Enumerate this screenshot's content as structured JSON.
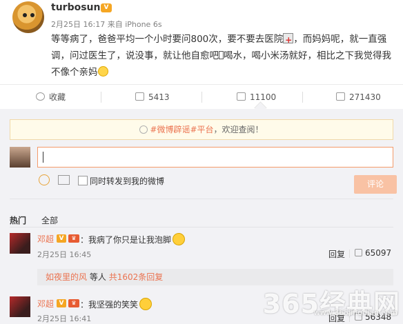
{
  "post": {
    "username": "turbosun",
    "time": "2月25日 16:17",
    "source": "来自 iPhone 6s",
    "text_part1": "等等病了，爸爸平均一个小时要问800次，要不要去医院",
    "text_part2": "，而妈妈呢，就一直强调，问过医生了，说没事，就让他自愈吧",
    "text_part3": "喝水，喝小米汤就好，相比之下我觉得我不像个亲妈"
  },
  "actions": {
    "favorite_label": "收藏",
    "repost_count": "5413",
    "comment_count": "11100",
    "like_count": "271430"
  },
  "notice": {
    "topic": "#微博辟谣#平台",
    "suffix": "，欢迎查阅！"
  },
  "composer": {
    "input_value": "",
    "repost_checkbox_label": "同时转发到我的微博",
    "submit_label": "评论"
  },
  "tabs": {
    "hot": "热门",
    "all": "全部"
  },
  "comments": [
    {
      "name": "邓超",
      "text": "：我病了你只是让我泡脚",
      "time": "2月25日 16:45",
      "reply_label": "回复",
      "likes": "65097"
    },
    {
      "name": "邓超",
      "text": "：我坚强的笑笑",
      "time": "2月25日 16:41",
      "reply_label": "回复",
      "likes": "56348"
    }
  ],
  "subreplies": {
    "first_user": "如夜里的风",
    "middle": "等人",
    "total": "共1602条回复"
  },
  "watermark": {
    "main": "365经典网",
    "sub": "www.365jingdian.com"
  },
  "colors": {
    "accent": "#eb7350",
    "vip": "#f5a623",
    "panel_bg": "#f2f2f5",
    "submit_disabled": "#f9c2a4"
  }
}
